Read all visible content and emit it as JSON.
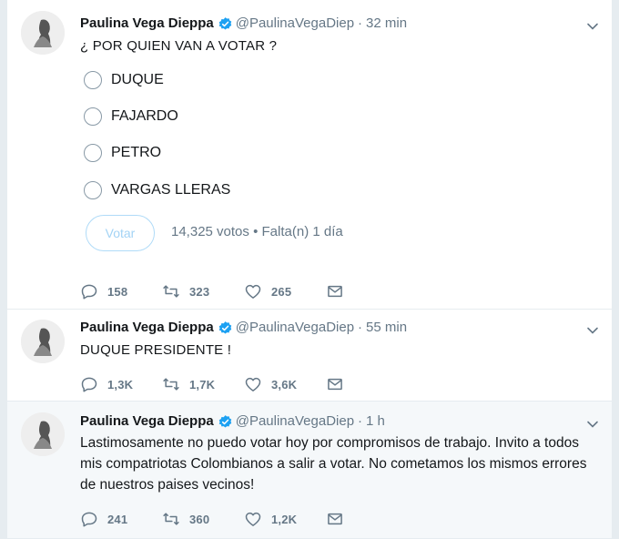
{
  "tweets": [
    {
      "name": "Paulina Vega Dieppa",
      "handle": "@PaulinaVegaDiep",
      "sep": "·",
      "time": "32 min",
      "text": "¿ POR QUIEN VAN A VOTAR ?",
      "poll": {
        "options": [
          "DUQUE",
          "FAJARDO",
          "PETRO",
          "VARGAS LLERAS"
        ],
        "vote_label": "Votar",
        "votes": "14,325 votos",
        "meta_sep": "•",
        "remaining": "Falta(n) 1 día"
      },
      "replies": "158",
      "retweets": "323",
      "likes": "265"
    },
    {
      "name": "Paulina Vega Dieppa",
      "handle": "@PaulinaVegaDiep",
      "sep": "·",
      "time": "55 min",
      "text": "DUQUE PRESIDENTE !",
      "replies": "1,3K",
      "retweets": "1,7K",
      "likes": "3,6K"
    },
    {
      "name": "Paulina Vega Dieppa",
      "handle": "@PaulinaVegaDiep",
      "sep": "·",
      "time": "1 h",
      "text": "Lastimosamente no puedo votar hoy por compromisos de trabajo. Invito a todos mis compatriotas Colombianos a salir a votar. No cometamos los mismos errores de nuestros paises vecinos!",
      "replies": "241",
      "retweets": "360",
      "likes": "1,2K"
    }
  ],
  "icons": {
    "verified": "verified-badge-icon",
    "caret": "chevron-down-icon",
    "reply": "reply-icon",
    "retweet": "retweet-icon",
    "like": "heart-icon",
    "dm": "envelope-icon"
  },
  "colors": {
    "verified": "#1da1f2",
    "muted": "#657786",
    "vote_border": "#b0dbf8",
    "highlight_bg": "#f5f8fa"
  }
}
